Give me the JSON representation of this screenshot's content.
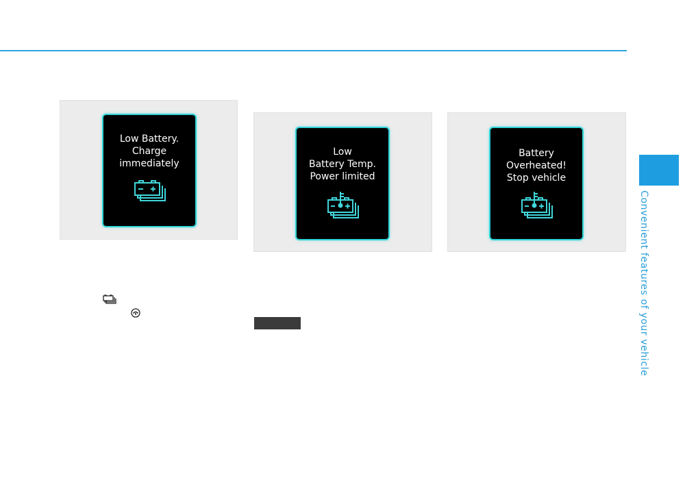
{
  "side_tab": {
    "title": "Convenient features of your vehicle",
    "accent": "#1e9ee0"
  },
  "warnings": [
    {
      "lines": [
        "Low Battery.",
        "Charge",
        "immediately"
      ],
      "icon": "battery-stack-icon"
    },
    {
      "lines": [
        "Low",
        "Battery Temp.",
        "Power limited"
      ],
      "icon": "battery-thermometer-icon"
    },
    {
      "lines": [
        "Battery",
        "Overheated!",
        "Stop vehicle"
      ],
      "icon": "battery-thermometer-icon"
    }
  ],
  "inline_icons": [
    "battery-stack-icon",
    "service-icon"
  ],
  "colors": {
    "rule": "#2ca6e0",
    "screen_border": "#2fd3d7",
    "icon": "#3fd6da",
    "panel": "#ececec"
  }
}
